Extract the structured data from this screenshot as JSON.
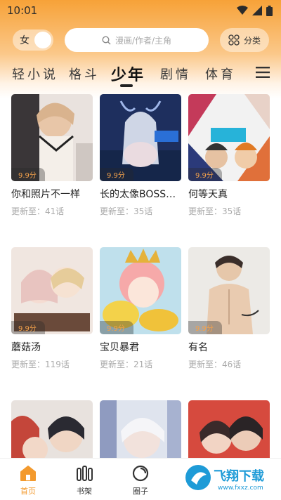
{
  "status_bar": {
    "time": "10:01"
  },
  "header": {
    "gender_label": "女",
    "search_placeholder": "漫画/作者/主角",
    "category_label": "分类"
  },
  "tabs": [
    {
      "label": "轻小说"
    },
    {
      "label": "格斗"
    },
    {
      "label": "少年",
      "active": true
    },
    {
      "label": "剧情"
    },
    {
      "label": "体育"
    }
  ],
  "comics": [
    {
      "title": "你和照片不一样",
      "score": "9.9分",
      "update": "更新至：41话"
    },
    {
      "title": "长的太像BOSS…",
      "score": "9.9分",
      "update": "更新至：35话"
    },
    {
      "title": "何等天真",
      "score": "9.9分",
      "update": "更新至：35话"
    },
    {
      "title": "蘑菇汤",
      "score": "9.9分",
      "update": "更新至：119话"
    },
    {
      "title": "宝贝暴君",
      "score": "9.9分",
      "update": "更新至：21话"
    },
    {
      "title": "有名",
      "score": "9.9分",
      "update": "更新至：46话"
    },
    {
      "title": "",
      "score": "",
      "update": ""
    },
    {
      "title": "",
      "score": "",
      "update": ""
    },
    {
      "title": "",
      "score": "",
      "update": ""
    }
  ],
  "bottom_nav": [
    {
      "label": "首页",
      "icon": "home-icon",
      "active": true
    },
    {
      "label": "书架",
      "icon": "bookshelf-icon"
    },
    {
      "label": "圈子",
      "icon": "circle-icon"
    }
  ],
  "watermark": {
    "text": "飞翔下载",
    "sub": "www.fxxz.com"
  },
  "colors": {
    "accent": "#f39a2e",
    "score": "#f3a14b"
  }
}
